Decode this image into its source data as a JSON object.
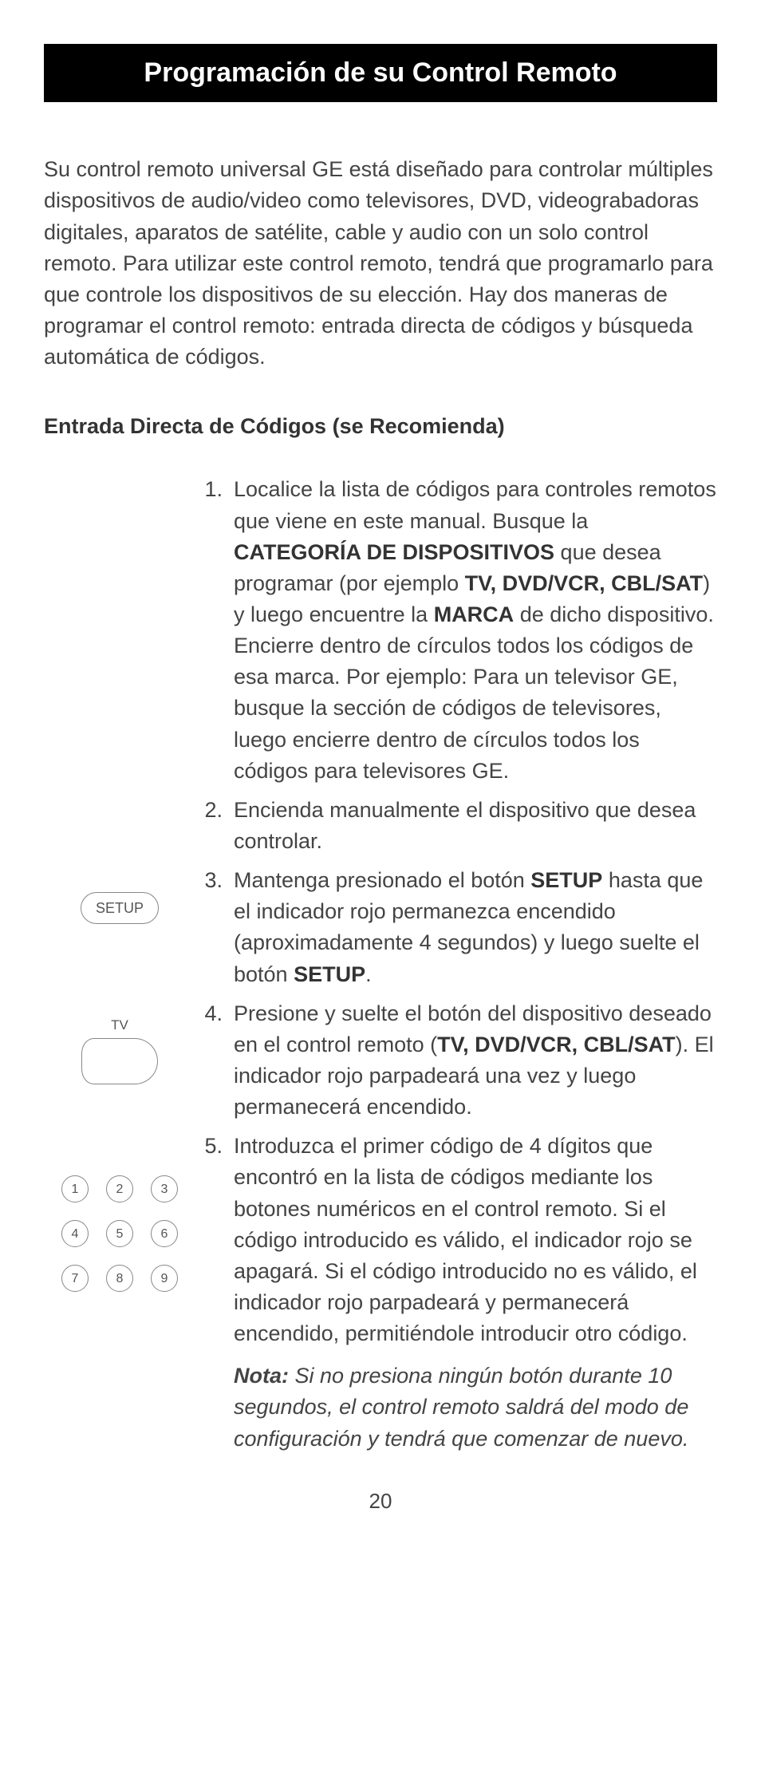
{
  "title": "Programación de su Control Remoto",
  "intro": "Su control remoto universal GE está diseñado para controlar múltiples dispositivos de audio/video como televisores, DVD, videograbadoras digitales, aparatos de satélite, cable y audio con un solo control remoto. Para utilizar este control remoto, tendrá que programarlo para que controle los dispositivos de su elección. Hay dos maneras de programar el control remoto: entrada directa de códigos y búsqueda automática de códigos.",
  "section_heading": "Entrada Directa de Códigos (se Recomienda)",
  "steps": {
    "s1": {
      "num": "1.",
      "t1": "Localice la lista de códigos para controles remotos que viene en este manual. Busque la ",
      "b1": "CATEGORÍA DE DISPOSITIVOS",
      "t2": " que desea programar (por ejemplo ",
      "b2": "TV, DVD/VCR, CBL/SAT",
      "t3": ") y luego encuentre la ",
      "b3": "MARCA",
      "t4": " de dicho dispositivo. Encierre dentro de círculos todos los códigos de esa marca. Por ejemplo: Para un televisor GE, busque la sección de códigos de televisores, luego encierre dentro de círculos todos los códigos para televisores GE."
    },
    "s2": {
      "num": "2.",
      "t1": "Encienda manualmente el dispositivo que desea controlar."
    },
    "s3": {
      "num": "3.",
      "t1": "Mantenga presionado el botón ",
      "b1": "SETUP",
      "t2": " hasta que el indicador rojo permanezca encendido (aproximadamente 4 segundos) y luego suelte el botón ",
      "b2": "SETUP",
      "t3": "."
    },
    "s4": {
      "num": "4.",
      "t1": "Presione y suelte el botón del dispositivo deseado en el control remoto (",
      "b1": "TV, DVD/VCR, CBL/SAT",
      "t2": "). El indicador rojo parpadeará una vez y luego permanecerá encendido."
    },
    "s5": {
      "num": "5.",
      "t1": "Introduzca el primer código de 4 dígitos que encontró en la lista de códigos mediante los botones numéricos en el control remoto. Si el código introducido es válido, el indicador rojo se apagará. Si el código introducido no es válido, el indicador rojo parpadeará y permanecerá encendido, permitiéndole introducir otro código.",
      "note_label": "Nota:",
      "note_text": " Si no presiona ningún botón durante 10 segundos, el control remoto saldrá del modo de configuración y tendrá que comenzar de nuevo."
    }
  },
  "icons": {
    "setup": "SETUP",
    "tv": "TV",
    "keys": [
      "1",
      "2",
      "3",
      "4",
      "5",
      "6",
      "7",
      "8",
      "9"
    ]
  },
  "page_number": "20"
}
